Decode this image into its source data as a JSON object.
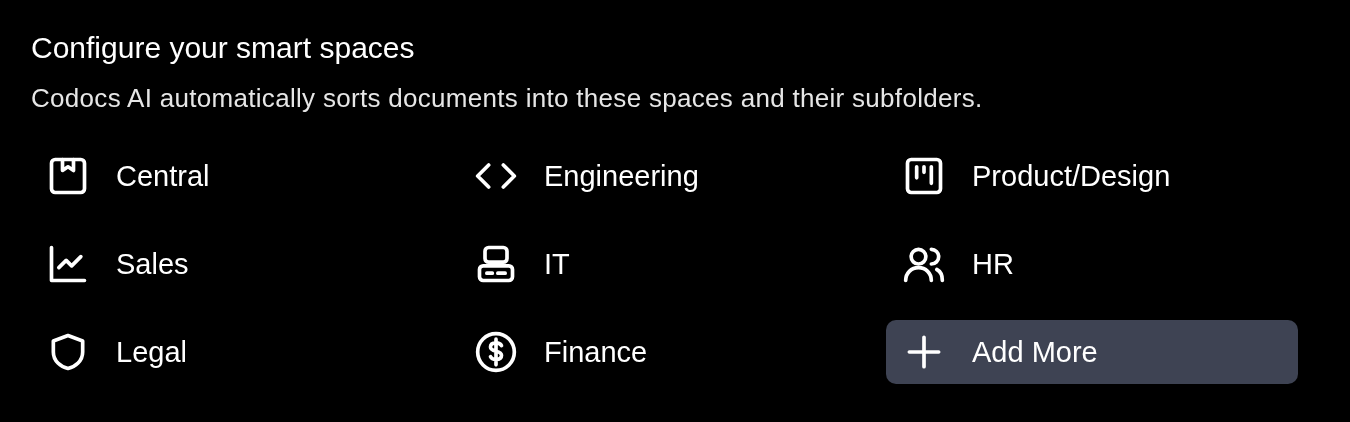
{
  "title": "Configure your smart spaces",
  "subtitle": "Codocs AI automatically sorts documents into these spaces and their subfolders.",
  "spaces": [
    {
      "kind": "space",
      "label": "Central"
    },
    {
      "kind": "space",
      "label": "Engineering"
    },
    {
      "kind": "space",
      "label": "Product/Design"
    },
    {
      "kind": "space",
      "label": "Sales"
    },
    {
      "kind": "space",
      "label": "IT"
    },
    {
      "kind": "space",
      "label": "HR"
    },
    {
      "kind": "space",
      "label": "Legal"
    },
    {
      "kind": "space",
      "label": "Finance"
    },
    {
      "kind": "add",
      "label": "Add More"
    }
  ]
}
